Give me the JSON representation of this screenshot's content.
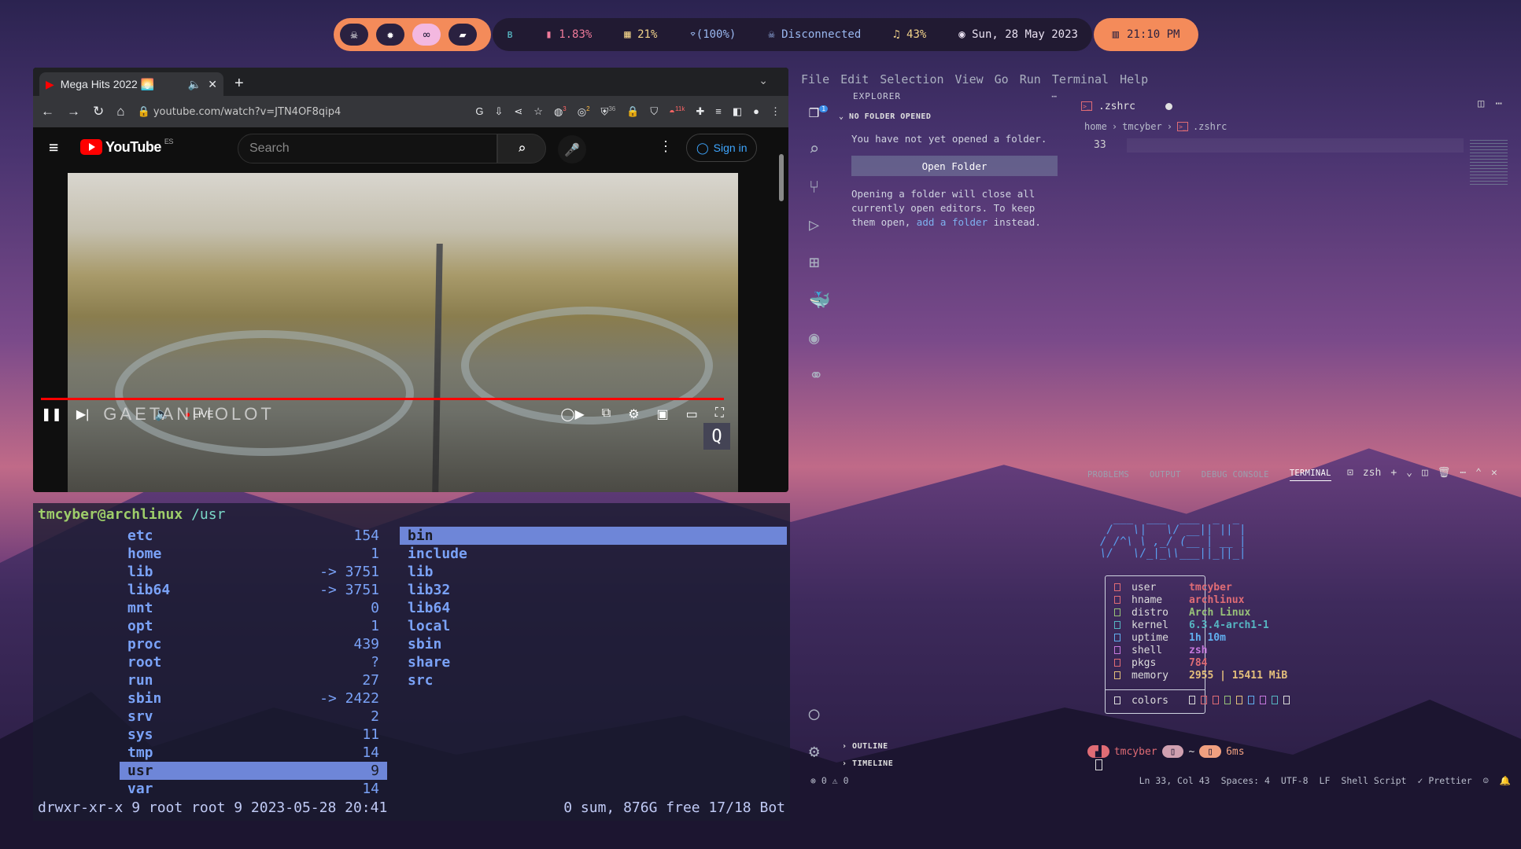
{
  "topbar": {
    "workspaces": [
      "☠",
      "✹",
      "∞",
      "▰"
    ],
    "active_workspace": 2,
    "bluetooth_icon": "ʙ",
    "cpu": "1.83%",
    "ram": "21%",
    "wifi": "(100%)",
    "vpn": "Disconnected",
    "volume": "43%",
    "date": "Sun, 28 May 2023",
    "time": "21:10 PM",
    "accent": "#f48b5a"
  },
  "browser": {
    "tab_title": "Mega Hits 2022 🌅",
    "url": "youtube.com/watch?v=JTN4OF8qip4",
    "search_placeholder": "Search",
    "signin": "Sign in",
    "logo_text": "YouTube",
    "region": "ES",
    "brand_watermark": "GAETANPIOLOT",
    "live": "LIVE",
    "badges": {
      "ext1": "3",
      "ext2": "2",
      "ext3": "36",
      "ext4": "11k"
    }
  },
  "terminal": {
    "user": "tmcyber@archlinux",
    "path": "/usr",
    "left_entries": [
      {
        "name": "etc",
        "size": "154"
      },
      {
        "name": "home",
        "size": "1"
      },
      {
        "name": "lib",
        "size": "-> 3751"
      },
      {
        "name": "lib64",
        "size": "-> 3751"
      },
      {
        "name": "mnt",
        "size": "0"
      },
      {
        "name": "opt",
        "size": "1"
      },
      {
        "name": "proc",
        "size": "439"
      },
      {
        "name": "root",
        "size": "?"
      },
      {
        "name": "run",
        "size": "27"
      },
      {
        "name": "sbin",
        "size": "-> 2422"
      },
      {
        "name": "srv",
        "size": "2"
      },
      {
        "name": "sys",
        "size": "11"
      },
      {
        "name": "tmp",
        "size": "14"
      },
      {
        "name": "usr",
        "size": "9"
      },
      {
        "name": "var",
        "size": "14"
      }
    ],
    "left_selected": 13,
    "right_entries": [
      "bin",
      "include",
      "lib",
      "lib32",
      "lib64",
      "local",
      "sbin",
      "share",
      "src"
    ],
    "right_selected": 0,
    "status_left": "drwxr-xr-x 9 root root 9 2023-05-28 20:41",
    "status_right": "0 sum, 876G free  17/18  Bot"
  },
  "vscode": {
    "menu": [
      "File",
      "Edit",
      "Selection",
      "View",
      "Go",
      "Run",
      "Terminal",
      "Help"
    ],
    "explorer_title": "EXPLORER",
    "no_folder": "NO FOLDER OPENED",
    "no_folder_msg": "You have not yet opened a folder.",
    "open_folder": "Open Folder",
    "closing_msg_1": "Opening a folder will close all currently open editors. To keep them open,",
    "closing_link": "add a folder",
    "closing_msg_2": "instead.",
    "outline": "OUTLINE",
    "timeline": "TIMELINE",
    "tab_name": ".zshrc",
    "crumbs": [
      "home",
      "tmcyber",
      ".zshrc"
    ],
    "line_number": "33",
    "activity_badge": "1",
    "panel_tabs": [
      "PROBLEMS",
      "OUTPUT",
      "DEBUG CONSOLE",
      "TERMINAL"
    ],
    "shell": "zsh",
    "fetch": {
      "keys": [
        "user",
        "hname",
        "distro",
        "kernel",
        "uptime",
        "shell",
        "pkgs",
        "memory"
      ],
      "values": [
        "tmcyber",
        "archlinux",
        "Arch Linux",
        "6.3.4-arch1-1",
        "1h 10m",
        "zsh",
        "784",
        "2955 | 15411 MiB"
      ],
      "value_colors": [
        "#e06c75",
        "#e06c75",
        "#98c379",
        "#56b6c2",
        "#61afef",
        "#c678dd",
        "#e06c75",
        "#e5c07b"
      ],
      "key_colors": [
        "#e06c75",
        "#e06c75",
        "#98c379",
        "#56b6c2",
        "#61afef",
        "#c678dd",
        "#e06c75",
        "#e5c07b"
      ],
      "colors_label": "colors",
      "palette": [
        "#dcdcdc",
        "#e06c75",
        "#e06c75",
        "#98c379",
        "#e5c07b",
        "#61afef",
        "#c678dd",
        "#56b6c2",
        "#dcdcdc"
      ]
    },
    "prompt": {
      "user": "tmcyber",
      "dir": "~",
      "time": "6ms"
    },
    "status": {
      "errors": "0",
      "warnings": "0",
      "position": "Ln 33, Col 43",
      "spaces": "Spaces: 4",
      "encoding": "UTF-8",
      "eol": "LF",
      "language": "Shell Script",
      "formatter": "Prettier"
    }
  }
}
